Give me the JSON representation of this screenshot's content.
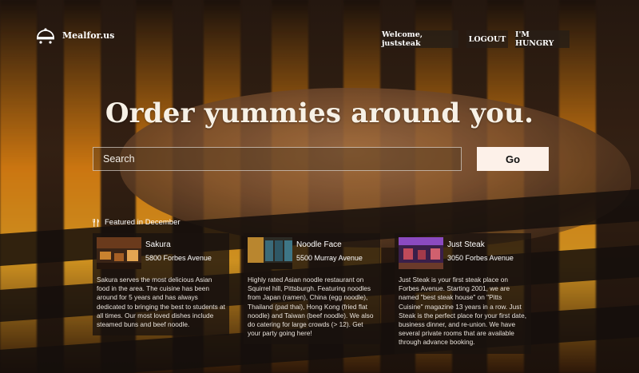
{
  "brand": {
    "name": "Mealfor.us"
  },
  "nav": {
    "welcome": "Welcome, juststeak",
    "logout": "LOGOUT",
    "hungry": "I'M HUNGRY"
  },
  "hero": {
    "headline": "Order yummies around you."
  },
  "search": {
    "placeholder": "Search",
    "value": "",
    "button": "Go"
  },
  "featured": {
    "label": "Featured in December",
    "restaurants": [
      {
        "name": "Sakura",
        "address": "5800 Forbes Avenue",
        "description": "Sakura serves the most delicious Asian food in the area. The cuisine has been around for 5 years and has always dedicated to bringing the best to students at all times. Our most loved dishes include steamed buns and beef noodle."
      },
      {
        "name": "Noodle Face",
        "address": "5500 Murray Avenue",
        "description": "Highly rated Asian noodle restaurant on Squirrel hill, Pittsburgh. Featuring noodles from Japan (ramen), China (egg noodle), Thailand (pad thai), Hong Kong (fried flat noodle) and Taiwan (beef noodle). We also do catering for large crowds (> 12). Get your party going here!"
      },
      {
        "name": "Just Steak",
        "address": "3050 Forbes Avenue",
        "description": "Just Steak is your first steak place on Forbes Avenue. Starting 2001, we are named \"best steak house\" on \"Pitts Cuisine\" magazine 13 years in a row. Just Steak is the perfect place for your first date, business dinner, and re-union. We have several private rooms that are available through advance booking."
      }
    ]
  }
}
